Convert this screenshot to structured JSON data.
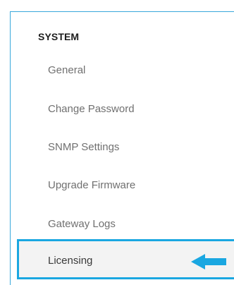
{
  "sidebar": {
    "section_title": "SYSTEM",
    "items": [
      {
        "label": "General"
      },
      {
        "label": "Change Password"
      },
      {
        "label": "SNMP Settings"
      },
      {
        "label": "Upgrade Firmware"
      },
      {
        "label": "Gateway Logs"
      },
      {
        "label": "Licensing"
      }
    ],
    "selected_index": 5,
    "highlight_color": "#1aa7e1",
    "arrow_icon": "arrow-left-icon"
  }
}
